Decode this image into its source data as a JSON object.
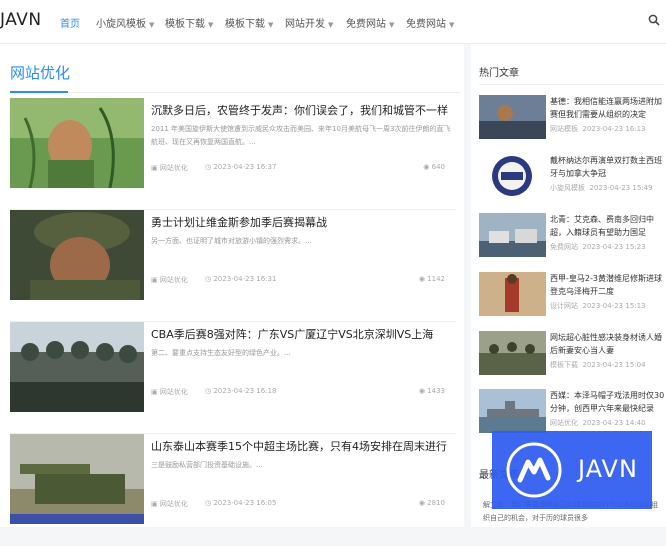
{
  "brand": {
    "logo": "JAVN",
    "accent_color": "#2d8cf0"
  },
  "nav": {
    "items": [
      {
        "label": "首页",
        "active": true,
        "dropdown": false
      },
      {
        "label": "小旋风模板",
        "active": false,
        "dropdown": true
      },
      {
        "label": "模板下载",
        "active": false,
        "dropdown": true
      },
      {
        "label": "模板下载",
        "active": false,
        "dropdown": true
      },
      {
        "label": "网站开发",
        "active": false,
        "dropdown": true
      },
      {
        "label": "免费网站",
        "active": false,
        "dropdown": true
      },
      {
        "label": "免费网站",
        "active": false,
        "dropdown": true
      }
    ],
    "search_icon": "search-icon"
  },
  "main": {
    "section_title": "网站优化",
    "articles": [
      {
        "title": "沉默多日后，农管终于发声：你们误会了，我们和城管不一样",
        "excerpt": "2011 年美国旋伊斯大使馆遭到示威民众攻击而美园、来年10月美航母飞一周3次前往伊朗的直飞航班、现在又再恢复两国直航。...",
        "category": "网站优化",
        "date": "2023-04-23 16:37",
        "views": "640"
      },
      {
        "title": "勇士计划让维金斯参加季后赛揭幕战",
        "excerpt": "另一方面、也证明了城市对旅游小镇的强烈需求。...",
        "category": "网站优化",
        "date": "2023-04-23 16:31",
        "views": "1142"
      },
      {
        "title": "CBA季后赛8强对阵：广东VS广厦辽宁VS北京深圳VS上海",
        "excerpt": "第二、要重点支持生态友好型的绿色产业。...",
        "category": "网站优化",
        "date": "2023-04-23 16:18",
        "views": "1433"
      },
      {
        "title": "山东泰山本赛季15个中超主场比赛，只有4场安排在周末进行",
        "excerpt": "三是鼓励私营部门投资基础设施。...",
        "category": "网站优化",
        "date": "2023-04-23 16:05",
        "views": "2810"
      }
    ]
  },
  "sidebar": {
    "title": "热门文章",
    "items": [
      {
        "title": "基德：我相信能连赢两场进附加赛但我们需要从组织的决定",
        "category": "网站模板",
        "date": "2023-04-23 16:13"
      },
      {
        "title": "戴杯纳达尔再演单双打数主西班牙与加拿大争冠",
        "category": "小旋风模板",
        "date": "2023-04-23 15:49"
      },
      {
        "title": "北青：艾克森、费南多回归中超，入籍球员有望助力国足",
        "category": "免费网站",
        "date": "2023-04-23 15:23"
      },
      {
        "title": "西甲-皇马2-3黄潜维尼修斯进球登克乌泽梅开二度",
        "category": "设计网站",
        "date": "2023-04-23 15:13"
      },
      {
        "title": "网坛超心脏性感决装身材诱人婚后新妻安心当人妻",
        "category": "模板下载",
        "date": "2023-04-23 15:04"
      },
      {
        "title": "西媒：本泽马帽子戏法用时仅30分钟，创西甲六年来最快纪录",
        "category": "网站优化",
        "date": "2023-04-23 14:40"
      }
    ],
    "title_2": "最新文章",
    "bottom_text": "解立帆：我们需要提高自己的球感和执行力以及抓住和组织自己的机会，对于历的球员很多"
  },
  "watermark": {
    "text": "JAVN"
  }
}
